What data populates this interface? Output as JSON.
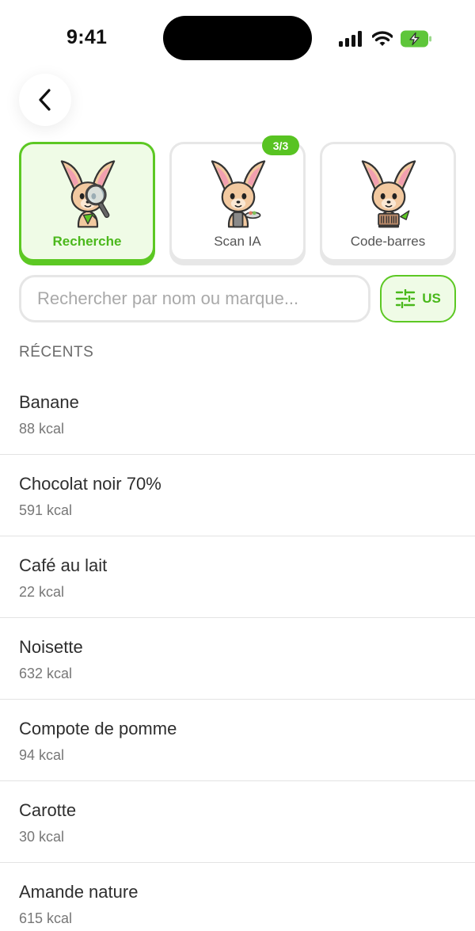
{
  "status_bar": {
    "time": "9:41"
  },
  "modes": [
    {
      "label": "Recherche",
      "active": true
    },
    {
      "label": "Scan IA",
      "active": false,
      "badge": "3/3"
    },
    {
      "label": "Code-barres",
      "active": false
    }
  ],
  "search": {
    "placeholder": "Rechercher par nom ou marque...",
    "value": ""
  },
  "filter": {
    "label": "US"
  },
  "recents": {
    "title": "RÉCENTS",
    "items": [
      {
        "name": "Banane",
        "kcal": "88 kcal"
      },
      {
        "name": "Chocolat noir 70%",
        "kcal": "591 kcal"
      },
      {
        "name": "Café au lait",
        "kcal": "22 kcal"
      },
      {
        "name": "Noisette",
        "kcal": "632 kcal"
      },
      {
        "name": "Compote de pomme",
        "kcal": "94 kcal"
      },
      {
        "name": "Carotte",
        "kcal": "30 kcal"
      },
      {
        "name": "Amande nature",
        "kcal": "615 kcal"
      }
    ]
  },
  "colors": {
    "accent": "#5cc823",
    "accent_light": "#effbe6",
    "text": "#2e2e2e",
    "muted": "#777777"
  },
  "icons": [
    "back-chevron-icon",
    "signal-icon",
    "wifi-icon",
    "battery-icon",
    "filter-sliders-icon",
    "fennec-mascot-icon"
  ]
}
